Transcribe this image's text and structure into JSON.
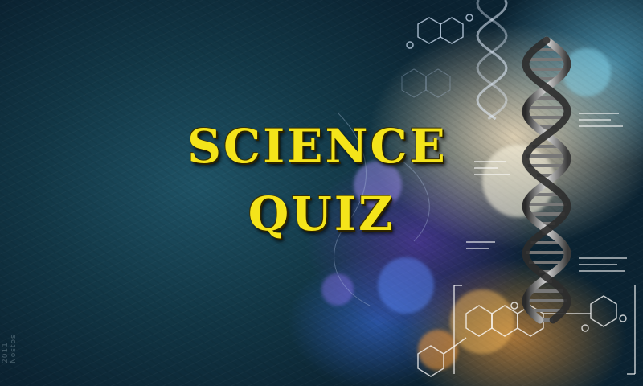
{
  "title": {
    "line1": "SCIENCE",
    "line2": "QUIZ"
  },
  "credit": "2011 Nostos",
  "colors": {
    "title_fill": "#f4e41a",
    "background_dark": "#0b2332",
    "background_teal": "#1f5366"
  },
  "decor": {
    "dna_helix": "dna-helix-graphic",
    "molecules": "chemical-structure-graphic",
    "bokeh": "bokeh-lights"
  }
}
